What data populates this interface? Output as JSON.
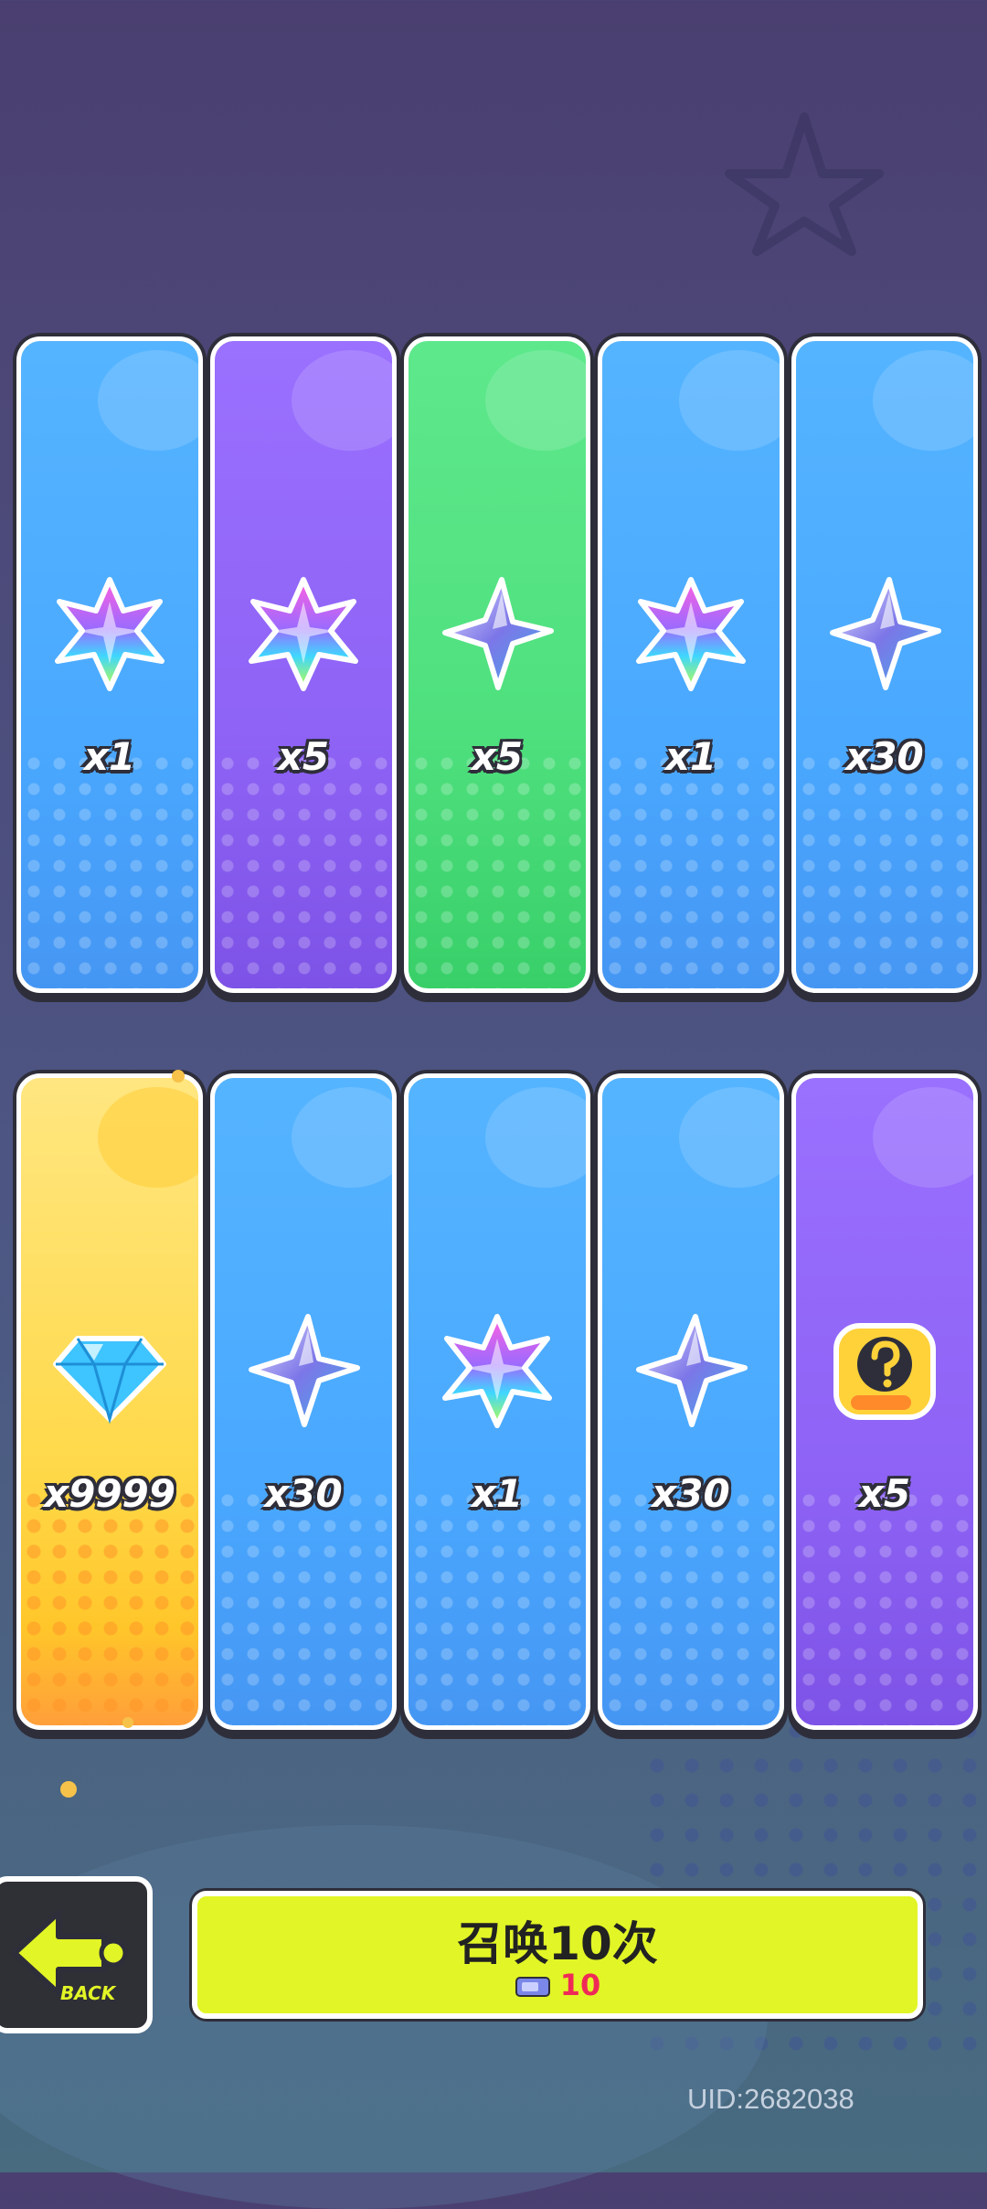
{
  "cards": [
    {
      "color": "blue",
      "icon": "rainbow-flower-crystal-icon",
      "qty": "x1"
    },
    {
      "color": "purple",
      "icon": "rainbow-flower-crystal-icon",
      "qty": "x5"
    },
    {
      "color": "green",
      "icon": "blue-star-shard-icon",
      "qty": "x5"
    },
    {
      "color": "blue",
      "icon": "rainbow-flower-crystal-icon",
      "qty": "x1"
    },
    {
      "color": "blue",
      "icon": "blue-star-shard-icon",
      "qty": "x30"
    },
    {
      "color": "gold",
      "icon": "diamond-gem-icon",
      "qty": "x9999"
    },
    {
      "color": "blue",
      "icon": "blue-star-shard-icon",
      "qty": "x30"
    },
    {
      "color": "blue",
      "icon": "rainbow-flower-crystal-icon",
      "qty": "x1"
    },
    {
      "color": "blue",
      "icon": "blue-star-shard-icon",
      "qty": "x30"
    },
    {
      "color": "purple",
      "icon": "mystery-sticker-icon",
      "qty": "x5"
    }
  ],
  "back_button": {
    "label": "BACK",
    "icon": "arrow-left-icon"
  },
  "summon_button": {
    "title": "召唤10次",
    "cost": "10",
    "cost_icon": "ticket-icon"
  },
  "uid_text": "UID:2682038",
  "colors": {
    "accent": "#e2f526",
    "cost": "#ef2a57"
  }
}
